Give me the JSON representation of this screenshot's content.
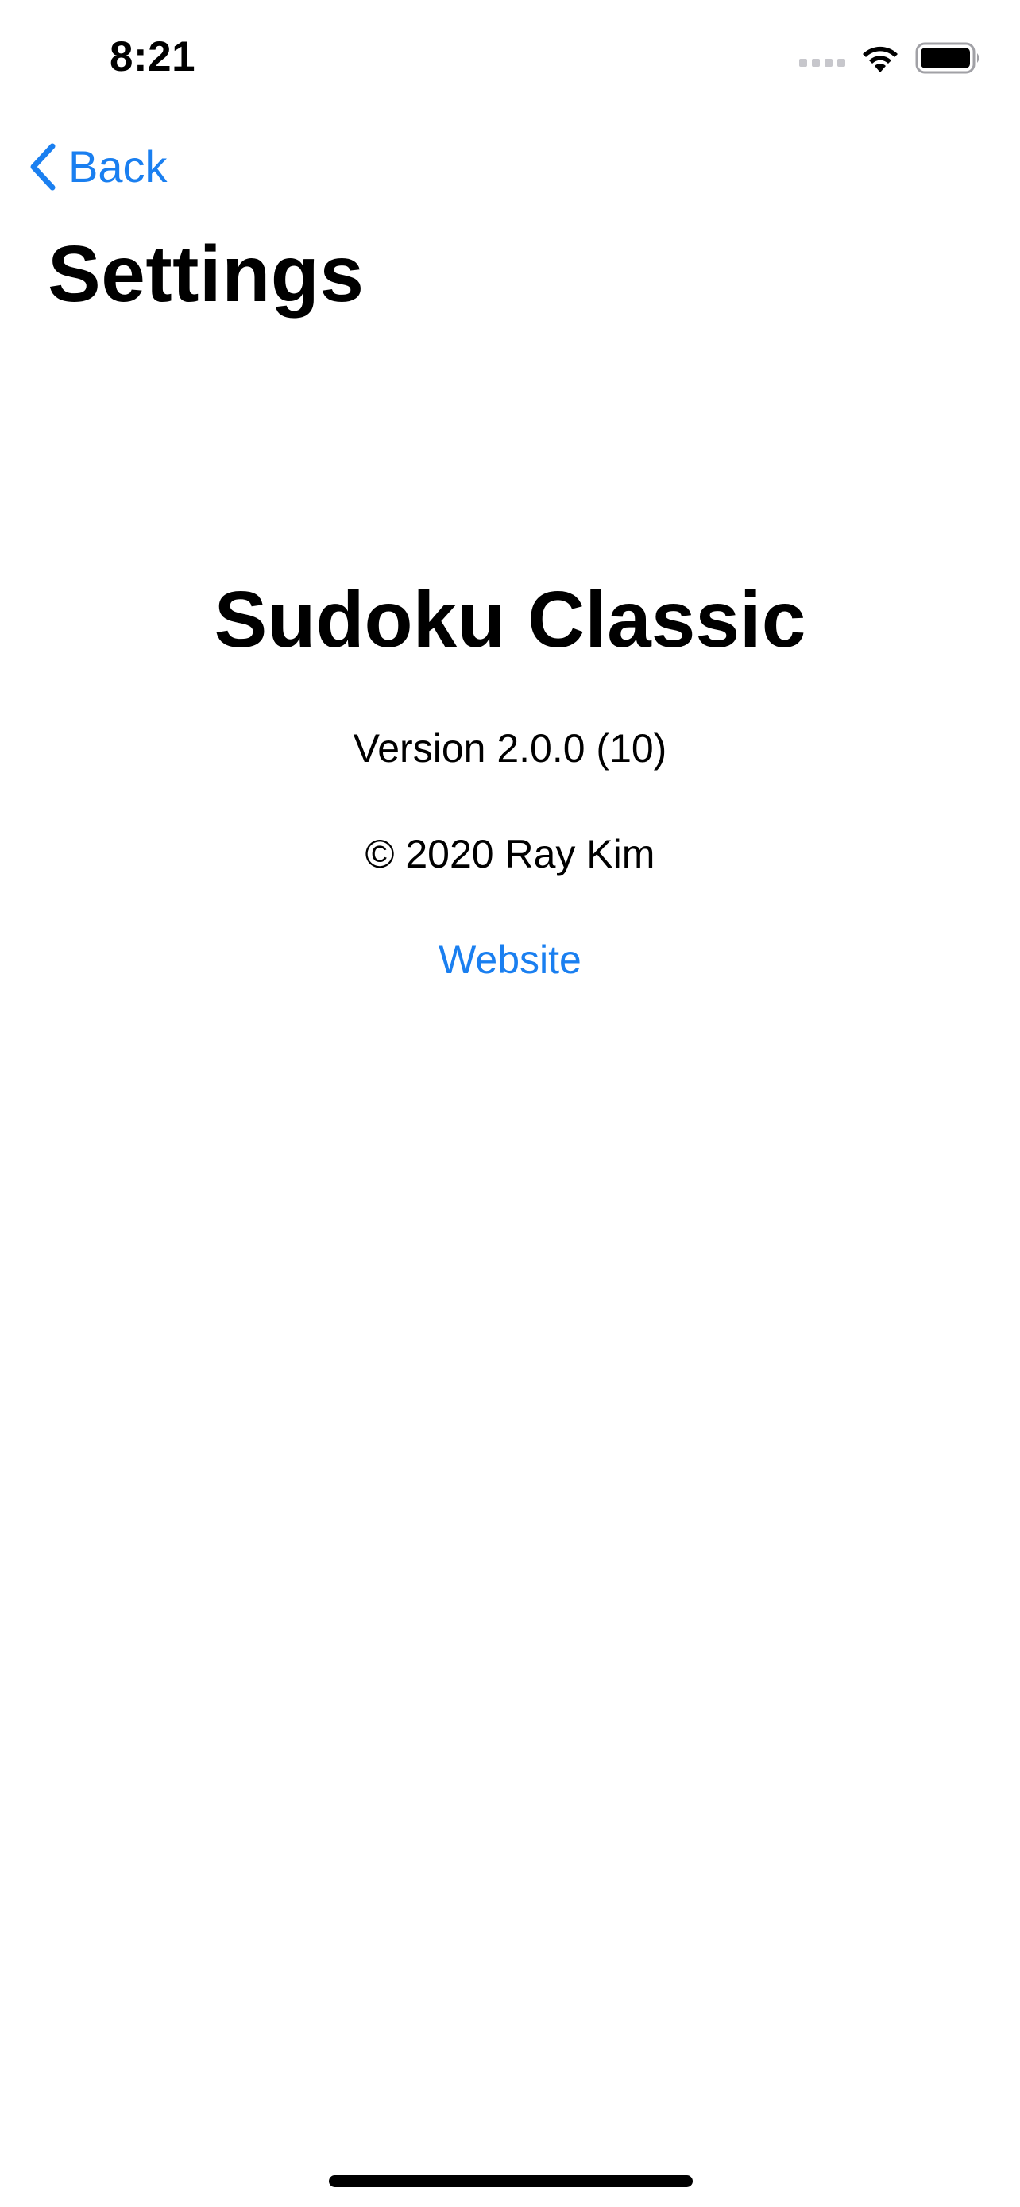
{
  "status_bar": {
    "time": "8:21"
  },
  "nav": {
    "back_label": "Back"
  },
  "page": {
    "title": "Settings"
  },
  "about": {
    "app_name": "Sudoku Classic",
    "version": "Version 2.0.0 (10)",
    "copyright": "© 2020 Ray Kim",
    "website_label": "Website"
  },
  "colors": {
    "accent": "#1a7ff0",
    "text": "#000000",
    "background": "#ffffff"
  },
  "icons": {
    "back": "chevron-left-icon",
    "signal": "cellular-signal-icon",
    "wifi": "wifi-icon",
    "battery": "battery-icon"
  }
}
